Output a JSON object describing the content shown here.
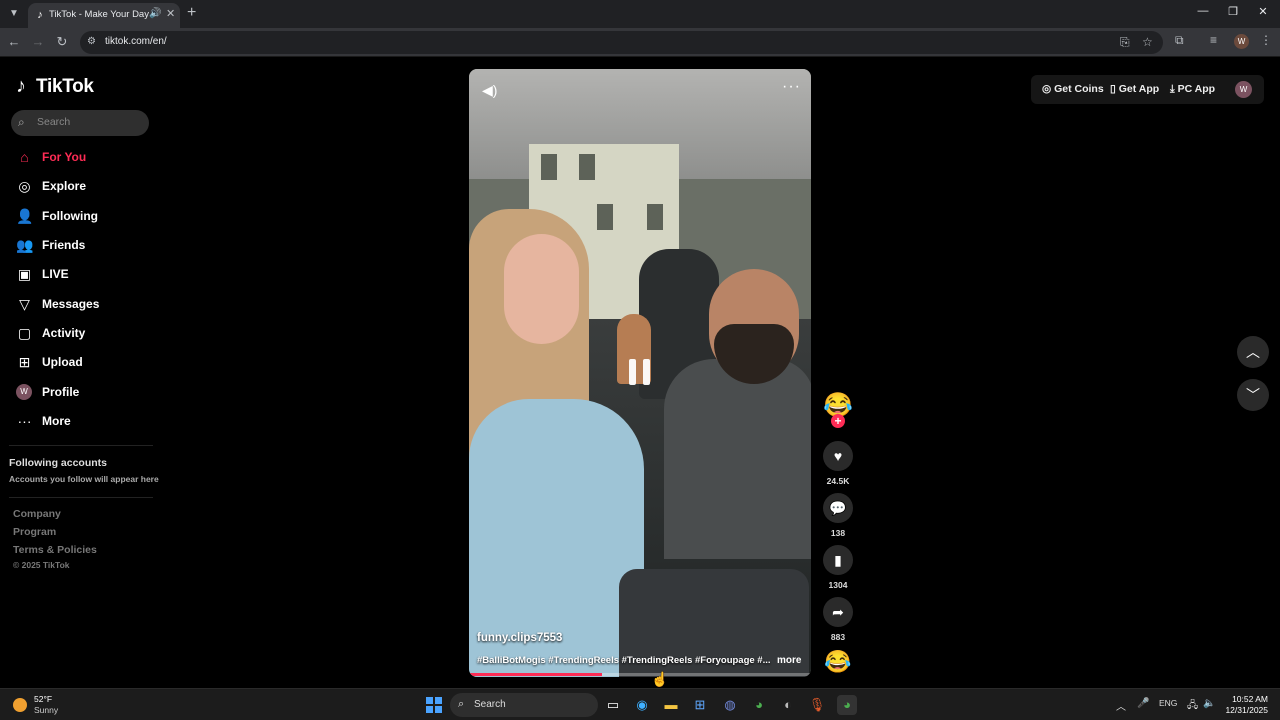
{
  "browser": {
    "tab_title": "TikTok - Make Your Day",
    "url": "tiktok.com/en/",
    "profile_initial": "W"
  },
  "sidebar": {
    "logo": "TikTok",
    "search_placeholder": "Search",
    "nav": [
      {
        "label": "For You",
        "icon": "home-icon",
        "active": true
      },
      {
        "label": "Explore",
        "icon": "compass-icon"
      },
      {
        "label": "Following",
        "icon": "following-icon"
      },
      {
        "label": "Friends",
        "icon": "friends-icon"
      },
      {
        "label": "LIVE",
        "icon": "live-icon"
      },
      {
        "label": "Messages",
        "icon": "messages-icon"
      },
      {
        "label": "Activity",
        "icon": "activity-icon"
      },
      {
        "label": "Upload",
        "icon": "upload-icon"
      },
      {
        "label": "Profile",
        "icon": "avatar",
        "initial": "W"
      },
      {
        "label": "More",
        "icon": "more-icon"
      }
    ],
    "following_title": "Following accounts",
    "following_sub": "Accounts you follow will appear here",
    "footer": [
      "Company",
      "Program",
      "Terms & Policies"
    ],
    "copyright": "© 2025 TikTok"
  },
  "video": {
    "username": "funny.clips7553",
    "hashtags": "#BalliBotMogis #TrendingReels #TrendingReels #Foryoupage #...",
    "more_label": "more",
    "progress": 0.39
  },
  "actions": {
    "likes": "24.5K",
    "comments": "138",
    "saves": "1304",
    "shares": "883"
  },
  "topright": {
    "get_coins": "Get Coins",
    "get_app": "Get App",
    "pc_app": "PC App",
    "avatar_initial": "W"
  },
  "taskbar": {
    "temp": "52°F",
    "condition": "Sunny",
    "search_label": "Search",
    "lang": "ENG",
    "time": "10:52 AM",
    "date": "12/31/2025"
  },
  "colors": {
    "accent": "#fe2c55",
    "background": "#000000"
  }
}
